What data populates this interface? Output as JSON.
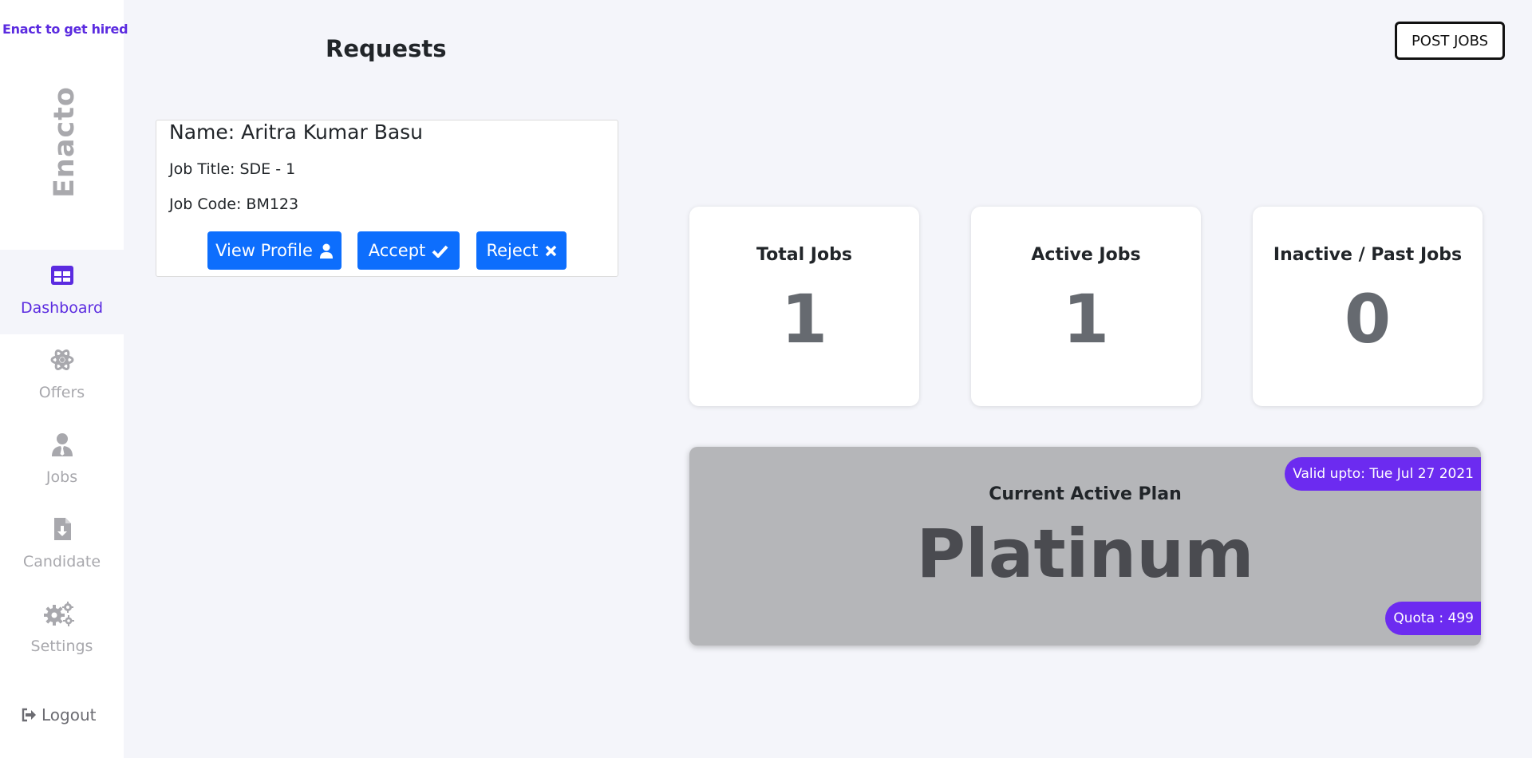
{
  "sidebar": {
    "tagline": "Enact to get hired",
    "brand": "Enacto",
    "items": [
      {
        "label": "Dashboard",
        "icon": "dashboard-icon",
        "active": true
      },
      {
        "label": "Offers",
        "icon": "atom-icon",
        "active": false
      },
      {
        "label": "Jobs",
        "icon": "user-tie-icon",
        "active": false
      },
      {
        "label": "Candidate",
        "icon": "file-download-icon",
        "active": false
      },
      {
        "label": "Settings",
        "icon": "gears-icon",
        "active": false
      }
    ],
    "logout": "Logout"
  },
  "header": {
    "title": "Requests",
    "post_jobs": "POST JOBS"
  },
  "request": {
    "name": "Name: Aritra Kumar Basu",
    "job_title": "Job Title: SDE - 1",
    "job_code": "Job Code: BM123",
    "view_profile": "View Profile",
    "accept": "Accept",
    "reject": "Reject"
  },
  "stats": [
    {
      "title": "Total Jobs",
      "value": "1"
    },
    {
      "title": "Active Jobs",
      "value": "1"
    },
    {
      "title": "Inactive / Past Jobs",
      "value": "0"
    }
  ],
  "plan": {
    "label": "Current Active Plan",
    "name": "Platinum",
    "valid": "Valid upto: Tue Jul 27 2021",
    "quota": "Quota : 499"
  },
  "colors": {
    "accent": "#5b2be0",
    "pill": "#6c2bf0",
    "button": "#0d6efd",
    "icon_inactive": "#a8a8ad"
  }
}
